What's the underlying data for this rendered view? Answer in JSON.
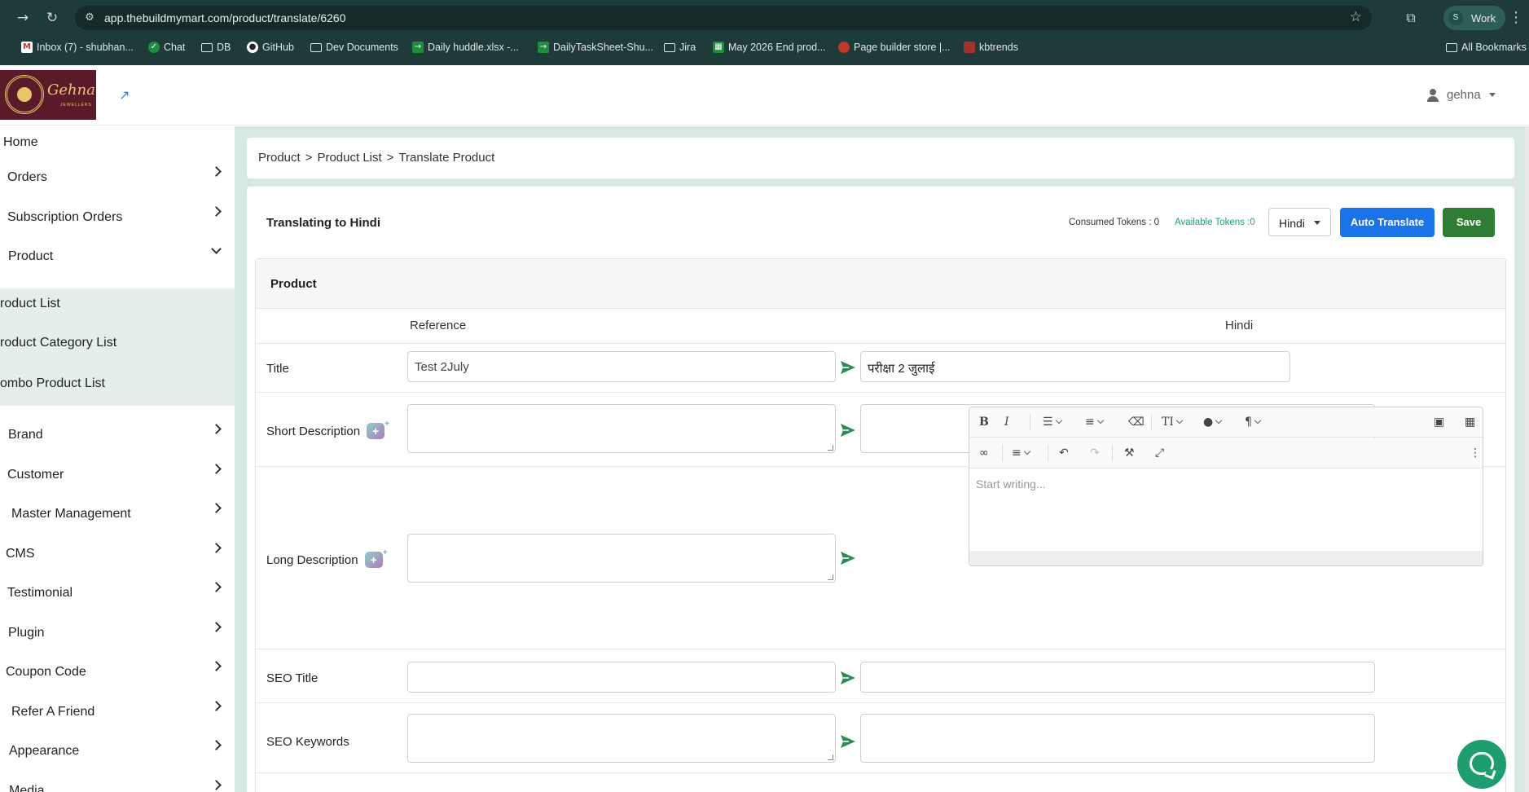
{
  "browser": {
    "url": "app.thebuildmymart.com/product/translate/6260",
    "profile_initial": "S",
    "profile_label": "Work",
    "bookmarks": [
      {
        "label": "Inbox (7) - shubhan...",
        "icon": "gmail-icon",
        "color": "#d93025"
      },
      {
        "label": "Chat",
        "icon": "chat-icon",
        "color": "#1e8e3e"
      },
      {
        "label": "DB",
        "icon": "folder-icon",
        "color": ""
      },
      {
        "label": "GitHub",
        "icon": "github-icon",
        "color": "#ffffff"
      },
      {
        "label": "Dev Documents",
        "icon": "folder-icon",
        "color": ""
      },
      {
        "label": "Daily huddle.xlsx -...",
        "icon": "sheets-icon",
        "color": "#1e8e3e"
      },
      {
        "label": "DailyTaskSheet-Shu...",
        "icon": "sheets-icon",
        "color": "#1e8e3e"
      },
      {
        "label": "Jira",
        "icon": "folder-icon",
        "color": ""
      },
      {
        "label": "May 2026 End prod...",
        "icon": "sheets-icon",
        "color": "#1e8e3e"
      },
      {
        "label": "Page builder store |...",
        "icon": "avatar-icon",
        "color": "#c0392b"
      },
      {
        "label": "kbtrends",
        "icon": "kbtrends-icon",
        "color": "#a0322e"
      }
    ],
    "all_bookmarks": "All Bookmarks"
  },
  "header": {
    "brand": "Gehna",
    "brand_sub": "JEWELLERS",
    "username": "gehna"
  },
  "sidebar": {
    "items": [
      {
        "label": "Home",
        "chevron": "none"
      },
      {
        "label": "Orders",
        "chevron": "right"
      },
      {
        "label": "Subscription Orders",
        "chevron": "right"
      },
      {
        "label": "Product",
        "chevron": "down"
      },
      {
        "label": "roduct List",
        "chevron": "none",
        "sub": true
      },
      {
        "label": "roduct Category List",
        "chevron": "none",
        "sub": true
      },
      {
        "label": "ombo Product List",
        "chevron": "none",
        "sub": true
      },
      {
        "label": "Brand",
        "chevron": "right"
      },
      {
        "label": "Customer",
        "chevron": "right"
      },
      {
        "label": "Master Management",
        "chevron": "right"
      },
      {
        "label": "CMS",
        "chevron": "right"
      },
      {
        "label": "Testimonial",
        "chevron": "right"
      },
      {
        "label": "Plugin",
        "chevron": "right"
      },
      {
        "label": "Coupon Code",
        "chevron": "right"
      },
      {
        "label": "Refer A Friend",
        "chevron": "right"
      },
      {
        "label": "Appearance",
        "chevron": "right"
      },
      {
        "label": "Media",
        "chevron": "right"
      }
    ]
  },
  "breadcrumb": {
    "items": [
      "Product",
      "Product List",
      "Translate Product"
    ],
    "separator": ">"
  },
  "translate": {
    "title": "Translating to Hindi",
    "consumed_tokens": "Consumed Tokens : 0",
    "available_tokens": "Available Tokens :0",
    "language": "Hindi",
    "auto_translate_label": "Auto Translate",
    "save_label": "Save",
    "section_title": "Product",
    "col_reference": "Reference",
    "col_target": "Hindi",
    "rows": {
      "title": {
        "label": "Title",
        "reference": "Test 2July",
        "target": "परीक्षा 2 जुलाई"
      },
      "short_description": {
        "label": "Short Description",
        "reference": "",
        "target": ""
      },
      "long_description": {
        "label": "Long Description",
        "reference": "",
        "placeholder": "Start writing..."
      },
      "seo_title": {
        "label": "SEO Title",
        "reference": "",
        "target": ""
      },
      "seo_keywords": {
        "label": "SEO Keywords",
        "reference": "",
        "target": ""
      }
    }
  },
  "colors": {
    "accent_blue": "#1a73e8",
    "save_green": "#2e7d32",
    "available_green": "#20a36b",
    "send_icon": "#2e8b57",
    "page_bg": "#d8e9e5",
    "chat_fab": "#1e9e6e"
  }
}
